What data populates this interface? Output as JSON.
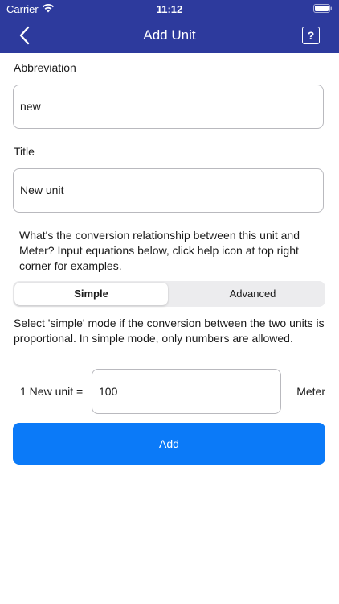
{
  "status_bar": {
    "carrier": "Carrier",
    "time": "11:12",
    "icons": [
      "wifi-icon",
      "battery-icon"
    ]
  },
  "nav": {
    "title": "Add Unit",
    "back_icon": "chevron-left-icon",
    "help_label": "?"
  },
  "form": {
    "abbreviation_label": "Abbreviation",
    "abbreviation_value": "new",
    "title_label": "Title",
    "title_value": "New unit",
    "relationship_text": "What's the conversion relationship between this unit and Meter? Input equations below, click help icon at top right corner for examples.",
    "mode_tabs": [
      "Simple",
      "Advanced"
    ],
    "selected_mode": "Simple",
    "mode_text": "Select 'simple' mode if the conversion between the two units is proportional. In simple mode, only numbers are allowed.",
    "equation_left": "1 New unit =",
    "equation_value": "100",
    "equation_unit": "Meter",
    "add_label": "Add"
  },
  "colors": {
    "nav_bg": "#2d3a9d",
    "accent": "#0b7af8",
    "segment_bg": "#ececee",
    "border": "#b9b9be"
  }
}
